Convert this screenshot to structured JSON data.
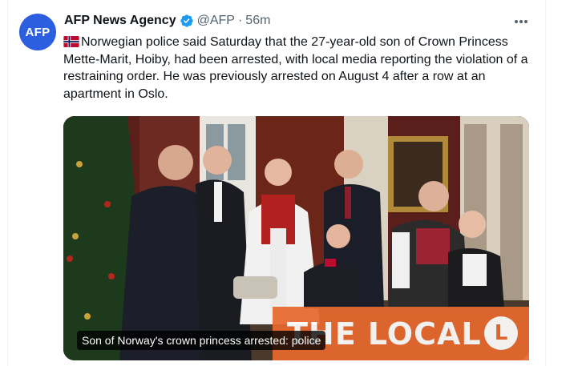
{
  "tweet": {
    "avatar_text": "AFP",
    "author_name": "AFP News Agency",
    "handle": "@AFP",
    "separator": "·",
    "timestamp": "56m",
    "body": "Norwegian police said Saturday that the 27-year-old son of Crown Princess Mette-Marit, Hoiby, had been arrested, with local media reporting the violation of a restraining order. He was previously arrested on August 4 after a row at an apartment in Oslo.",
    "flag_emoji_name": "norway-flag-icon"
  },
  "card": {
    "caption": "Son of Norway's crown princess arrested: police",
    "logo_text": "THE LOCAL",
    "logo_mark": "L"
  },
  "colors": {
    "brand_blue": "#2b5fe0",
    "verified_blue": "#1d9bf0",
    "secondary_text": "#536471",
    "the_local_orange": "#e8692f"
  }
}
